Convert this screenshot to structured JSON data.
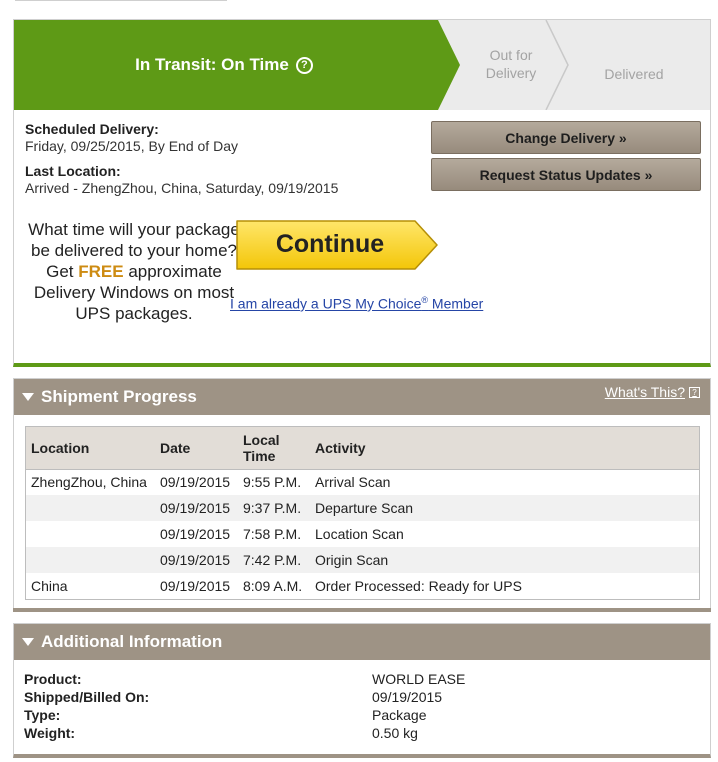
{
  "status": {
    "current_stage": "In Transit: On Time",
    "help_icon_glyph": "?",
    "stages": [
      "Out for Delivery",
      "Delivered"
    ],
    "active_color": "#5e9a16",
    "inactive_color": "#ebebeb"
  },
  "delivery": {
    "scheduled_label": "Scheduled Delivery:",
    "scheduled_value": "Friday, 09/25/2015, By End of Day",
    "last_location_label": "Last Location:",
    "last_location_value": "Arrived - ZhengZhou, China, Saturday, 09/19/2015"
  },
  "actions": {
    "change_delivery": "Change Delivery »",
    "request_updates": "Request Status Updates »"
  },
  "promo": {
    "text_before": "What time will your package be delivered to your home? Get ",
    "free": "FREE",
    "text_after": " approximate Delivery Windows on most UPS packages.",
    "continue_label": "Continue",
    "member_link_prefix": "I am already a UPS My Choice",
    "member_link_sup": "®",
    "member_link_suffix": " Member"
  },
  "shipment_progress": {
    "title": "Shipment Progress",
    "whats_this": "What's This?",
    "columns": [
      "Location",
      "Date",
      "Local Time",
      "Activity"
    ],
    "rows": [
      {
        "location": "ZhengZhou, China",
        "date": "09/19/2015",
        "time": "9:55 P.M.",
        "activity": "Arrival Scan"
      },
      {
        "location": "",
        "date": "09/19/2015",
        "time": "9:37 P.M.",
        "activity": "Departure Scan"
      },
      {
        "location": "",
        "date": "09/19/2015",
        "time": "7:58 P.M.",
        "activity": "Location Scan"
      },
      {
        "location": "",
        "date": "09/19/2015",
        "time": "7:42 P.M.",
        "activity": "Origin Scan"
      },
      {
        "location": "China",
        "date": "09/19/2015",
        "time": "8:09 A.M.",
        "activity": "Order Processed: Ready for UPS"
      }
    ]
  },
  "additional_info": {
    "title": "Additional Information",
    "items": [
      {
        "label": "Product:",
        "value": "WORLD EASE"
      },
      {
        "label": "Shipped/Billed On:",
        "value": "09/19/2015"
      },
      {
        "label": "Type:",
        "value": "Package"
      },
      {
        "label": "Weight:",
        "value": "0.50 kg"
      }
    ]
  }
}
